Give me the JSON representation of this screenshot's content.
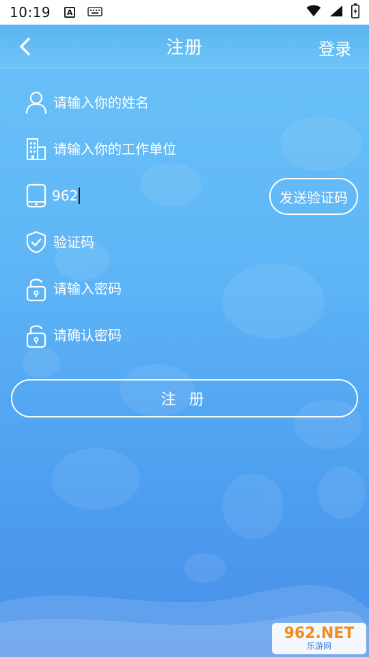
{
  "status_bar": {
    "time": "10:19",
    "indicator": "A"
  },
  "header": {
    "title": "注册",
    "login_label": "登录"
  },
  "form": {
    "name_placeholder": "请输入你的姓名",
    "company_placeholder": "请输入你的工作单位",
    "phone_value": "962",
    "send_code_label": "发送验证码",
    "code_placeholder": "验证码",
    "password_placeholder": "请输入密码",
    "confirm_password_placeholder": "请确认密码"
  },
  "register_label": "注 册",
  "watermark": {
    "brand": "962.NET",
    "site": "乐游网"
  },
  "icons": {
    "back": "chevron-left-icon",
    "name": "user-icon",
    "company": "building-icon",
    "phone": "phone-icon",
    "code": "shield-check-icon",
    "password": "lock-icon",
    "confirm_password": "lock-icon"
  },
  "colors": {
    "background_top": "#6cc3f8",
    "background_bottom": "#4a8fe9",
    "text": "#ffffff"
  }
}
